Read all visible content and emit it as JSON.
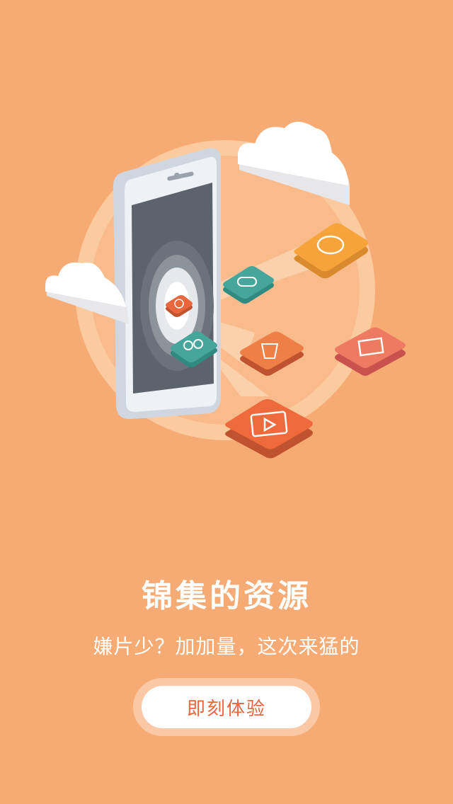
{
  "onboarding": {
    "title": "锦集的资源",
    "subtitle": "嫌片少？加加量，这次来猛的",
    "cta_label": "即刻体验"
  },
  "colors": {
    "background": "#f7ab74",
    "accent": "#e8673f",
    "button_bg": "#ffffff"
  },
  "icons": [
    "bear-face-icon",
    "gamepad-icon",
    "fire-icon",
    "glasses-icon",
    "shuttlecock-icon",
    "clapperboard-icon",
    "video-play-icon"
  ]
}
